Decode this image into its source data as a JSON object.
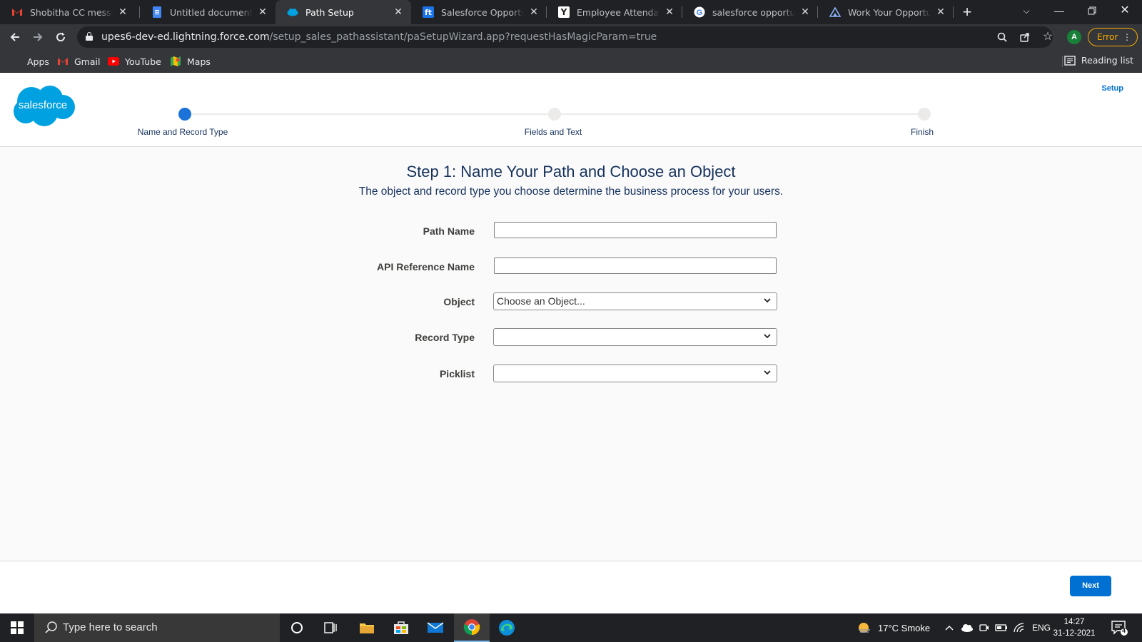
{
  "browser": {
    "tabs": [
      {
        "title": "Shobitha CC messaged",
        "icon": "gmail-icon",
        "active": false
      },
      {
        "title": "Untitled document - Google Docs",
        "icon": "docs-icon",
        "active": false
      },
      {
        "title": "Path Setup",
        "icon": "salesforce-cloud-icon",
        "active": true
      },
      {
        "title": "Salesforce Opportunity",
        "icon": "ft-icon",
        "active": false
      },
      {
        "title": "Employee Attendance Leave",
        "icon": "y-icon",
        "active": false
      },
      {
        "title": "salesforce opportunity",
        "icon": "google-icon",
        "active": false
      },
      {
        "title": "Work Your Opportunities",
        "icon": "trailhead-icon",
        "active": false
      }
    ],
    "url_host": "upes6-dev-ed.lightning.force.com",
    "url_path": "/setup_sales_pathassistant/paSetupWizard.app?requestHasMagicParam=true",
    "profile_initial": "A",
    "error_label": "Error",
    "bookmarks": [
      "Apps",
      "Gmail",
      "YouTube",
      "Maps"
    ],
    "reading_list": "Reading list"
  },
  "header": {
    "logo_text": "salesforce",
    "setup_link": "Setup",
    "steps": [
      {
        "label": "Name and Record Type",
        "active": true
      },
      {
        "label": "Fields and Text",
        "active": false
      },
      {
        "label": "Finish",
        "active": false
      }
    ]
  },
  "main": {
    "title": "Step 1: Name Your Path and Choose an Object",
    "subtitle": "The object and record type you choose determine the business process for your users.",
    "fields": {
      "path_name": {
        "label": "Path Name",
        "value": ""
      },
      "api_name": {
        "label": "API Reference Name",
        "value": ""
      },
      "object": {
        "label": "Object",
        "selected": "Choose an Object..."
      },
      "record_type": {
        "label": "Record Type",
        "selected": ""
      },
      "picklist": {
        "label": "Picklist",
        "selected": ""
      }
    }
  },
  "footer": {
    "next_label": "Next"
  },
  "taskbar": {
    "search_placeholder": "Type here to search",
    "weather": "17°C  Smoke",
    "language": "ENG",
    "time": "14:27",
    "date": "31-12-2021",
    "notification_count": "4"
  },
  "colors": {
    "accent": "#0070d2",
    "brand_blue": "#00a1e0",
    "title_navy": "#16325c",
    "progress_active": "#1b72d9"
  }
}
